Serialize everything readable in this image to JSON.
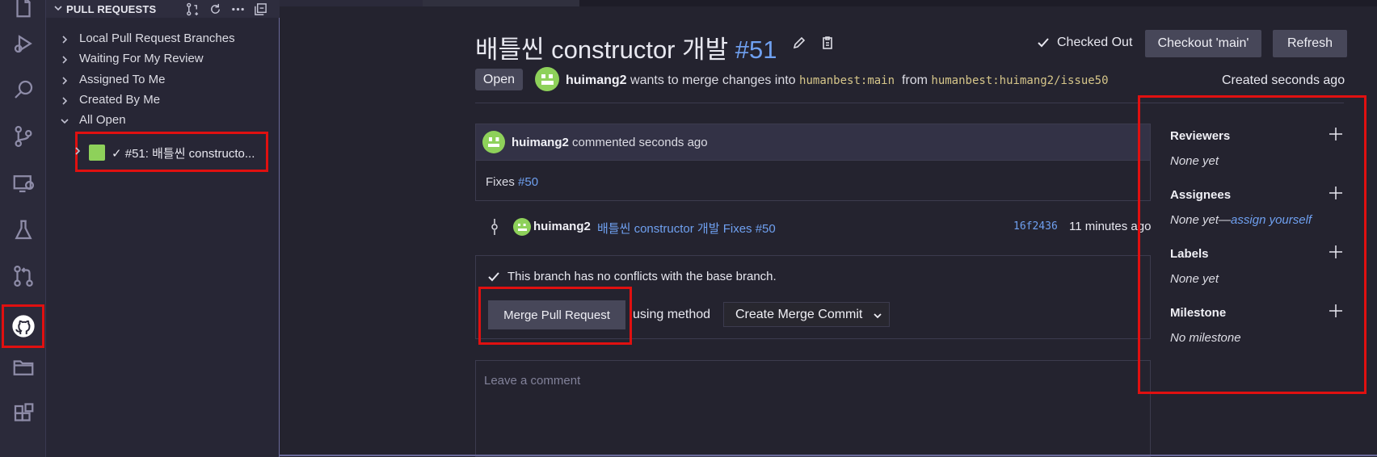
{
  "sidebar": {
    "title": "PULL REQUESTS",
    "items": [
      {
        "label": "Local Pull Request Branches"
      },
      {
        "label": "Waiting For My Review"
      },
      {
        "label": "Assigned To Me"
      },
      {
        "label": "Created By Me"
      },
      {
        "label": "All Open"
      }
    ],
    "pr_item": {
      "label": "✓ #51: 배틀씬 constructo..."
    }
  },
  "pr": {
    "title": "배틀씬 constructor 개발",
    "number": "#51",
    "checked_out": "Checked Out",
    "checkout_button": "Checkout 'main'",
    "refresh_button": "Refresh",
    "status": "Open",
    "author": "huimang2",
    "merge_text": "wants to merge changes into",
    "base_branch": "humanbest:main",
    "from_text": "from",
    "head_branch": "humanbest:huimang2/issue50",
    "created": "Created seconds ago"
  },
  "comment": {
    "author": "huimang2",
    "time": "commented seconds ago",
    "body_text": "Fixes",
    "body_link": "#50"
  },
  "commit": {
    "author": "huimang2",
    "message": "배틀씬 constructor 개발 Fixes #50",
    "sha": "16f2436",
    "time": "11 minutes ago"
  },
  "merge": {
    "status": "This branch has no conflicts with the base branch.",
    "button": "Merge Pull Request",
    "using_method": "using method",
    "method": "Create Merge Commit"
  },
  "comment_input": {
    "placeholder": "Leave a comment"
  },
  "right_panel": {
    "reviewers": {
      "title": "Reviewers",
      "value": "None yet"
    },
    "assignees": {
      "title": "Assignees",
      "value": "None yet—",
      "link": "assign yourself"
    },
    "labels": {
      "title": "Labels",
      "value": "None yet"
    },
    "milestone": {
      "title": "Milestone",
      "value": "No milestone"
    }
  },
  "colors": {
    "accent_link": "#6fa0f0",
    "highlight": "#e01010",
    "avatar": "#8ed15a"
  }
}
